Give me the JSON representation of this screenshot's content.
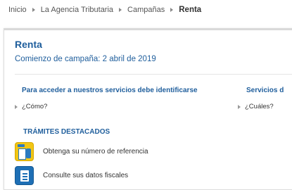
{
  "breadcrumb": {
    "items": [
      "Inicio",
      "La Agencia Tributaria",
      "Campañas"
    ],
    "current": "Renta"
  },
  "panel": {
    "title": "Renta",
    "subtitle": "Comienzo de campaña: 2 abril de 2019",
    "sections": [
      {
        "heading": "Para acceder a nuestros servicios debe identificarse",
        "link": "¿Cómo?"
      },
      {
        "heading": "Servicios d",
        "link": "¿Cuáles?"
      }
    ],
    "tramites": {
      "heading": "TRÁMITES DESTACADOS",
      "items": [
        {
          "label": "Obtenga su número de referencia",
          "icon": "mobile-reference-icon",
          "color": "#f2c614"
        },
        {
          "label": "Consulte sus datos fiscales",
          "icon": "tax-data-document-icon",
          "color": "#1e6fb5"
        }
      ]
    }
  },
  "colors": {
    "accent": "#1f5e9c",
    "text": "#333333"
  }
}
